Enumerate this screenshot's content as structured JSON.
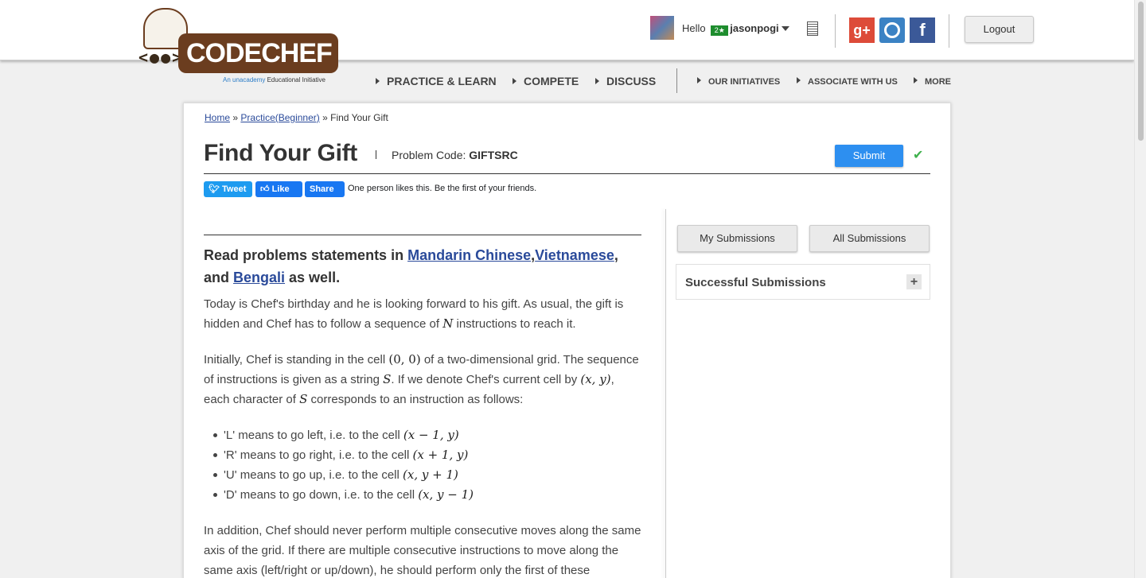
{
  "header": {
    "logo": {
      "text": "CODECHEF",
      "face": "<●●>",
      "tagline_prefix": "An ",
      "tagline_brand": "unacademy",
      "tagline_suffix": " Educational Initiative"
    },
    "user": {
      "greeting": "Hello",
      "flag": "2★",
      "username": "jasonpogi"
    },
    "social": {
      "google": "g+",
      "facebook": "f"
    },
    "logout_label": "Logout"
  },
  "nav": {
    "main": [
      "PRACTICE & LEARN",
      "COMPETE",
      "DISCUSS"
    ],
    "secondary": [
      "OUR INITIATIVES",
      "ASSOCIATE WITH US",
      "MORE"
    ]
  },
  "breadcrumb": {
    "home": "Home",
    "sep1": "»",
    "practice": "Practice(Beginner)",
    "sep2": "»",
    "current": "Find Your Gift"
  },
  "problem": {
    "title": "Find Your Gift",
    "code_label": "Problem Code:",
    "code": "GIFTSRC",
    "submit_label": "Submit"
  },
  "share": {
    "tweet": "Tweet",
    "like": "Like",
    "share": "Share",
    "likes_text": "One person likes this. Be the first of your friends."
  },
  "statement": {
    "lang_prefix": "Read problems statements in ",
    "lang1": "Mandarin Chinese",
    "lang_comma": ",",
    "lang2": "Vietnamese",
    "lang_and": ", and ",
    "lang3": "Bengali",
    "lang_suffix": " as well.",
    "p1a": "Today is Chef's birthday and he is looking forward to his gift. As usual, the gift is hidden and Chef has to follow a sequence of ",
    "p1_var": "N",
    "p1b": " instructions to reach it.",
    "p2a": "Initially, Chef is standing in the cell ",
    "p2_m1": "(0, 0)",
    "p2b": " of a two-dimensional grid. The sequence of instructions is given as a string ",
    "p2_var1": "S",
    "p2c": ". If we denote Chef's current cell by ",
    "p2_m2": "(x, y)",
    "p2d": ", each character of ",
    "p2_var2": "S",
    "p2e": " corresponds to an instruction as follows:",
    "bullets": [
      {
        "text": "'L' means to go left, i.e. to the cell ",
        "math": "(x − 1, y)"
      },
      {
        "text": "'R' means to go right, i.e. to the cell ",
        "math": "(x + 1, y)"
      },
      {
        "text": "'U' means to go up, i.e. to the cell ",
        "math": "(x, y + 1)"
      },
      {
        "text": "'D' means to go down, i.e. to the cell ",
        "math": "(x, y − 1)"
      }
    ],
    "p3": "In addition, Chef should never perform multiple consecutive moves along the same axis of the grid. If there are multiple consecutive instructions to move along the same axis (left/right or up/down), he should perform only the first of these"
  },
  "sidebar": {
    "my_submissions": "My Submissions",
    "all_submissions": "All Submissions",
    "successful_submissions": "Successful Submissions",
    "expand": "+"
  },
  "colors": {
    "brand_brown": "#6b3d1f",
    "link": "#2a4a9a",
    "submit_blue": "#2d8ff0",
    "check_green": "#3fb14d"
  }
}
